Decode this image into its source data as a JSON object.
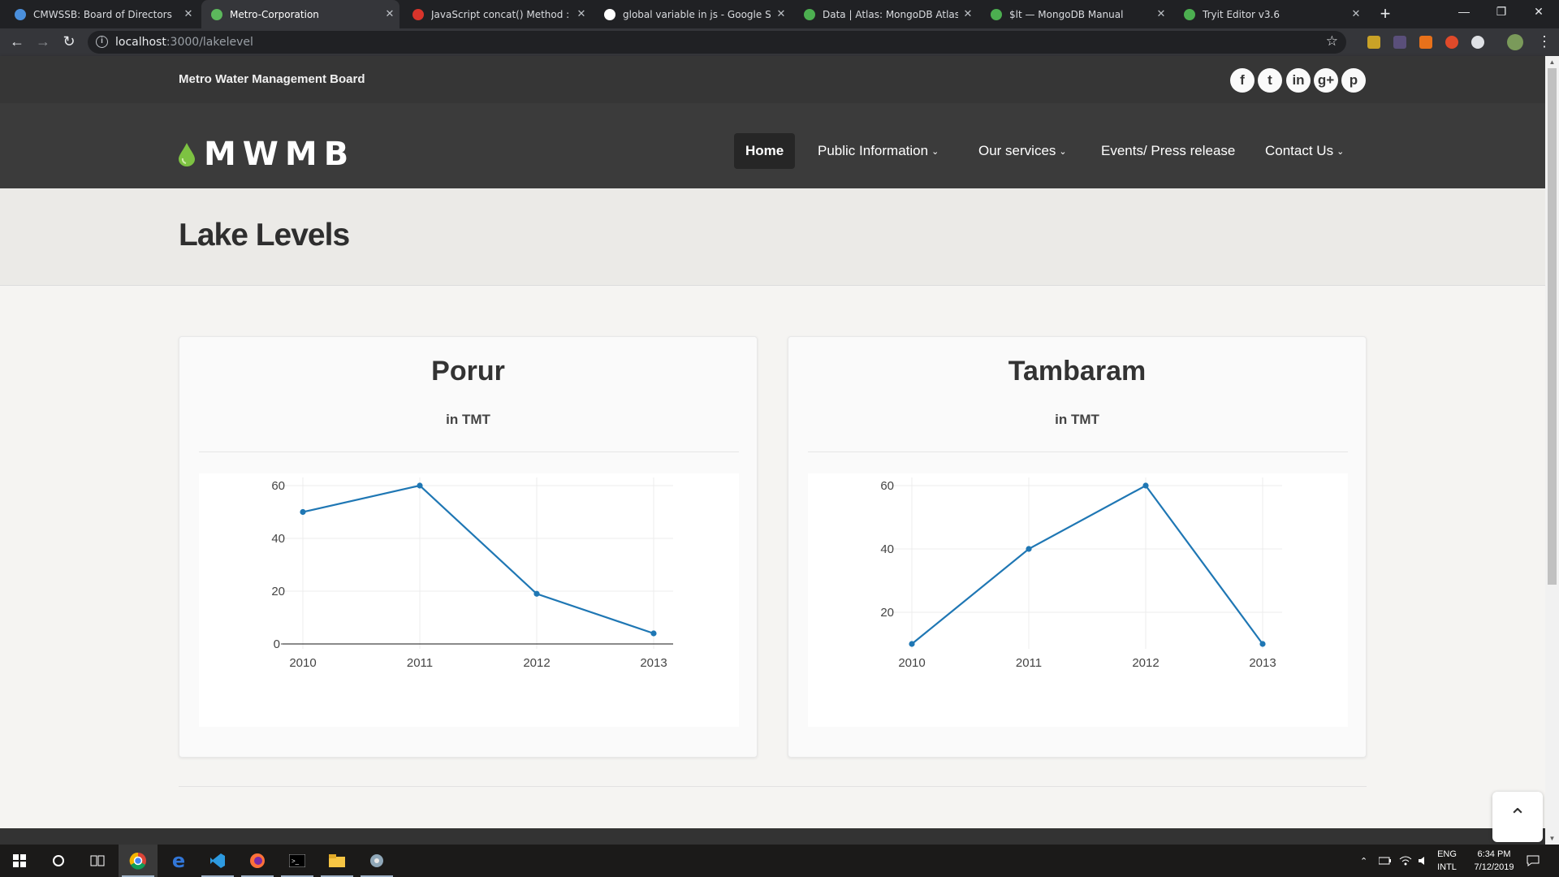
{
  "browser": {
    "tabs": [
      {
        "title": "CMWSSB: Board of Directors",
        "icon": "globe-icon",
        "color": "#4a8fdc",
        "active": false
      },
      {
        "title": "Metro-Corporation",
        "icon": "leaf-icon",
        "color": "#5cb85c",
        "active": true
      },
      {
        "title": "JavaScript concat() Method : Arra",
        "icon": "guru99-icon",
        "color": "#d9342b",
        "active": false
      },
      {
        "title": "global variable in js - Google Sea",
        "icon": "google-icon",
        "color": "#ffffff",
        "active": false
      },
      {
        "title": "Data | Atlas: MongoDB Atlas",
        "icon": "mongodb-leaf-icon",
        "color": "#4caf50",
        "active": false
      },
      {
        "title": "$lt — MongoDB Manual",
        "icon": "mongodb-leaf-icon",
        "color": "#4caf50",
        "active": false
      },
      {
        "title": "Tryit Editor v3.6",
        "icon": "w3schools-icon",
        "color": "#4caf50",
        "active": false
      }
    ],
    "url_host": "localhost",
    "url_path": ":3000/lakelevel"
  },
  "site": {
    "top_title": "Metro Water Management Board",
    "social": [
      {
        "name": "facebook-icon",
        "glyph": "f"
      },
      {
        "name": "twitter-icon",
        "glyph": "t"
      },
      {
        "name": "linkedin-icon",
        "glyph": "in"
      },
      {
        "name": "googleplus-icon",
        "glyph": "g+"
      },
      {
        "name": "pinterest-icon",
        "glyph": "p"
      }
    ],
    "logo_text": "MWMB",
    "nav": {
      "home": "Home",
      "public_info": "Public Information",
      "services": "Our services",
      "events": "Events/ Press release",
      "contact": "Contact Us"
    },
    "page_title": "Lake Levels"
  },
  "chart_data": [
    {
      "type": "line",
      "title": "Porur",
      "subtitle": "in TMT",
      "x": [
        2010,
        2011,
        2012,
        2013
      ],
      "series": [
        {
          "values": [
            50,
            60,
            19,
            4
          ]
        }
      ],
      "yticks": [
        0,
        20,
        40,
        60
      ],
      "ylim": [
        0,
        60
      ],
      "color": "#1f77b4",
      "grid": true
    },
    {
      "type": "line",
      "title": "Tambaram",
      "subtitle": "in TMT",
      "x": [
        2010,
        2011,
        2012,
        2013
      ],
      "series": [
        {
          "values": [
            10,
            40,
            60,
            10
          ]
        }
      ],
      "yticks": [
        20,
        40,
        60
      ],
      "ylim": [
        10,
        60
      ],
      "color": "#1f77b4",
      "grid": true
    }
  ],
  "taskbar": {
    "lang_top": "ENG",
    "lang_bottom": "INTL",
    "time": "6:34 PM",
    "date": "7/12/2019"
  }
}
